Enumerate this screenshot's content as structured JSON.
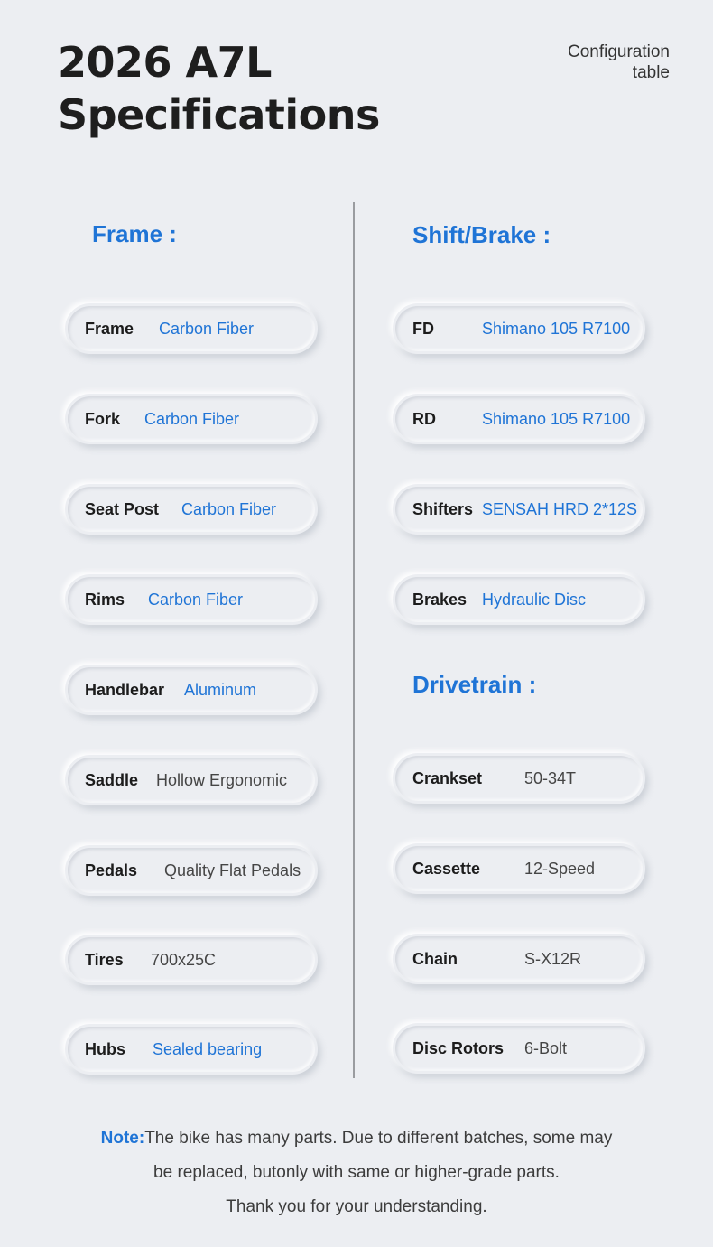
{
  "header": {
    "title_line1": "2026 A7L",
    "title_line2": "Specifications",
    "subtitle_line1": "Configuration",
    "subtitle_line2": "table"
  },
  "sections": {
    "frame": "Frame :",
    "shift_brake": "Shift/Brake :",
    "drivetrain": "Drivetrain :"
  },
  "left_specs": [
    {
      "label": "Frame",
      "value": "Carbon Fiber"
    },
    {
      "label": "Fork",
      "value": "Carbon Fiber"
    },
    {
      "label": "Seat Post",
      "value": "Carbon Fiber"
    },
    {
      "label": "Rims",
      "value": "Carbon Fiber"
    },
    {
      "label": "Handlebar",
      "value": "Aluminum"
    },
    {
      "label": "Saddle",
      "value": "Hollow Ergonomic"
    },
    {
      "label": "Pedals",
      "value": "Quality Flat Pedals"
    },
    {
      "label": "Tires",
      "value": "700x25C"
    },
    {
      "label": "Hubs",
      "value": "Sealed bearing"
    }
  ],
  "shift_specs": [
    {
      "label": "FD",
      "value": "Shimano 105 R7100"
    },
    {
      "label": "RD",
      "value": "Shimano 105 R7100"
    },
    {
      "label": "Shifters",
      "value": "SENSAH HRD 2*12S"
    },
    {
      "label": "Brakes",
      "value": "Hydraulic Disc"
    }
  ],
  "drivetrain_specs": [
    {
      "label": "Crankset",
      "value": "50-34T"
    },
    {
      "label": "Cassette",
      "value": "12-Speed"
    },
    {
      "label": "Chain",
      "value": "S-X12R"
    },
    {
      "label": "Disc Rotors",
      "value": "6-Bolt"
    }
  ],
  "note": {
    "label": "Note:",
    "line1": "The bike has many parts. Due to different batches, some may",
    "line2": "be replaced, butonly with same or higher-grade parts.",
    "line3": "Thank you for your understanding."
  },
  "colors": {
    "accent": "#1f74d6",
    "background": "#eceef2",
    "text": "#1e1e1e"
  }
}
